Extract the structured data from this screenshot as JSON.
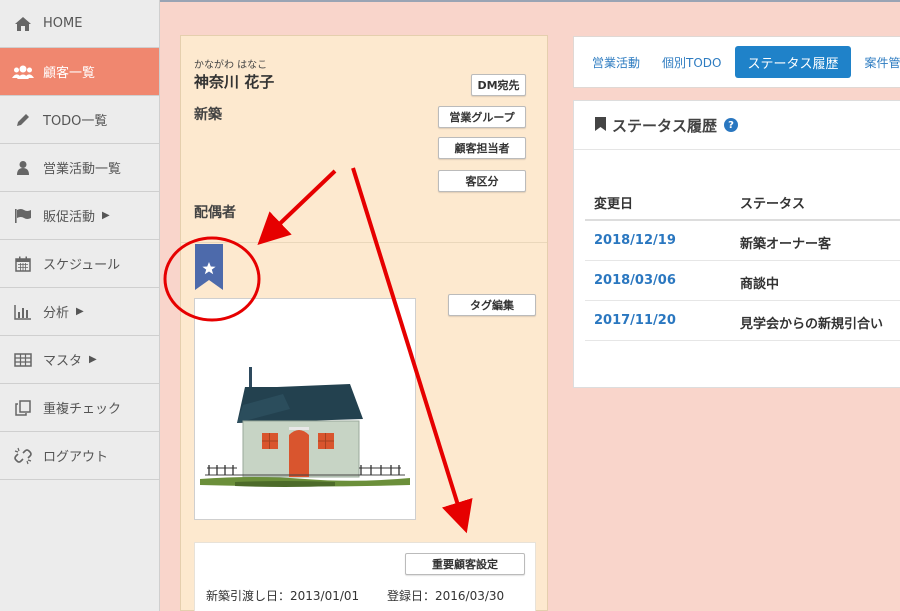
{
  "sidebar": {
    "items": [
      {
        "label": "HOME",
        "icon": "home-icon"
      },
      {
        "label": "顧客一覧",
        "icon": "users-icon",
        "active": true
      },
      {
        "label": "TODO一覧",
        "icon": "pencil-icon"
      },
      {
        "label": "営業活動一覧",
        "icon": "user-icon"
      },
      {
        "label": "販促活動",
        "icon": "flag-icon",
        "caret": "▶"
      },
      {
        "label": "スケジュール",
        "icon": "calendar-icon"
      },
      {
        "label": "分析",
        "icon": "bar-chart-icon",
        "caret": "▶"
      },
      {
        "label": "マスタ",
        "icon": "table-icon",
        "caret": "▶"
      },
      {
        "label": "重複チェック",
        "icon": "copy-icon"
      },
      {
        "label": "ログアウト",
        "icon": "unlink-icon"
      }
    ]
  },
  "customer": {
    "kana": "かながわ はなこ",
    "name": "神奈川 花子",
    "category": "新築",
    "spouse_label": "配偶者",
    "buttons": {
      "dm": "DM宛先",
      "group": "営業グループ",
      "staff": "顧客担当者",
      "class": "客区分",
      "tag": "タグ編集",
      "important": "重要顧客設定"
    },
    "handover_date": "新築引渡し日：2013/01/01",
    "register_date": "登録日：2016/03/30"
  },
  "tabs": [
    {
      "label": "営業活動"
    },
    {
      "label": "個別TODO"
    },
    {
      "label": "ステータス履歴",
      "active": true
    },
    {
      "label": "案件管理"
    }
  ],
  "status_panel": {
    "title": "ステータス履歴",
    "help": "?",
    "columns": [
      "変更日",
      "ステータス"
    ],
    "rows": [
      {
        "date": "2018/12/19",
        "status": "新築オーナー客"
      },
      {
        "date": "2018/03/06",
        "status": "商談中"
      },
      {
        "date": "2017/11/20",
        "status": "見学会からの新規引合い"
      }
    ]
  },
  "colors": {
    "accent": "#f0876f",
    "link": "#2a77c0",
    "annotation": "#e60000",
    "background": "#f9d5cb"
  }
}
